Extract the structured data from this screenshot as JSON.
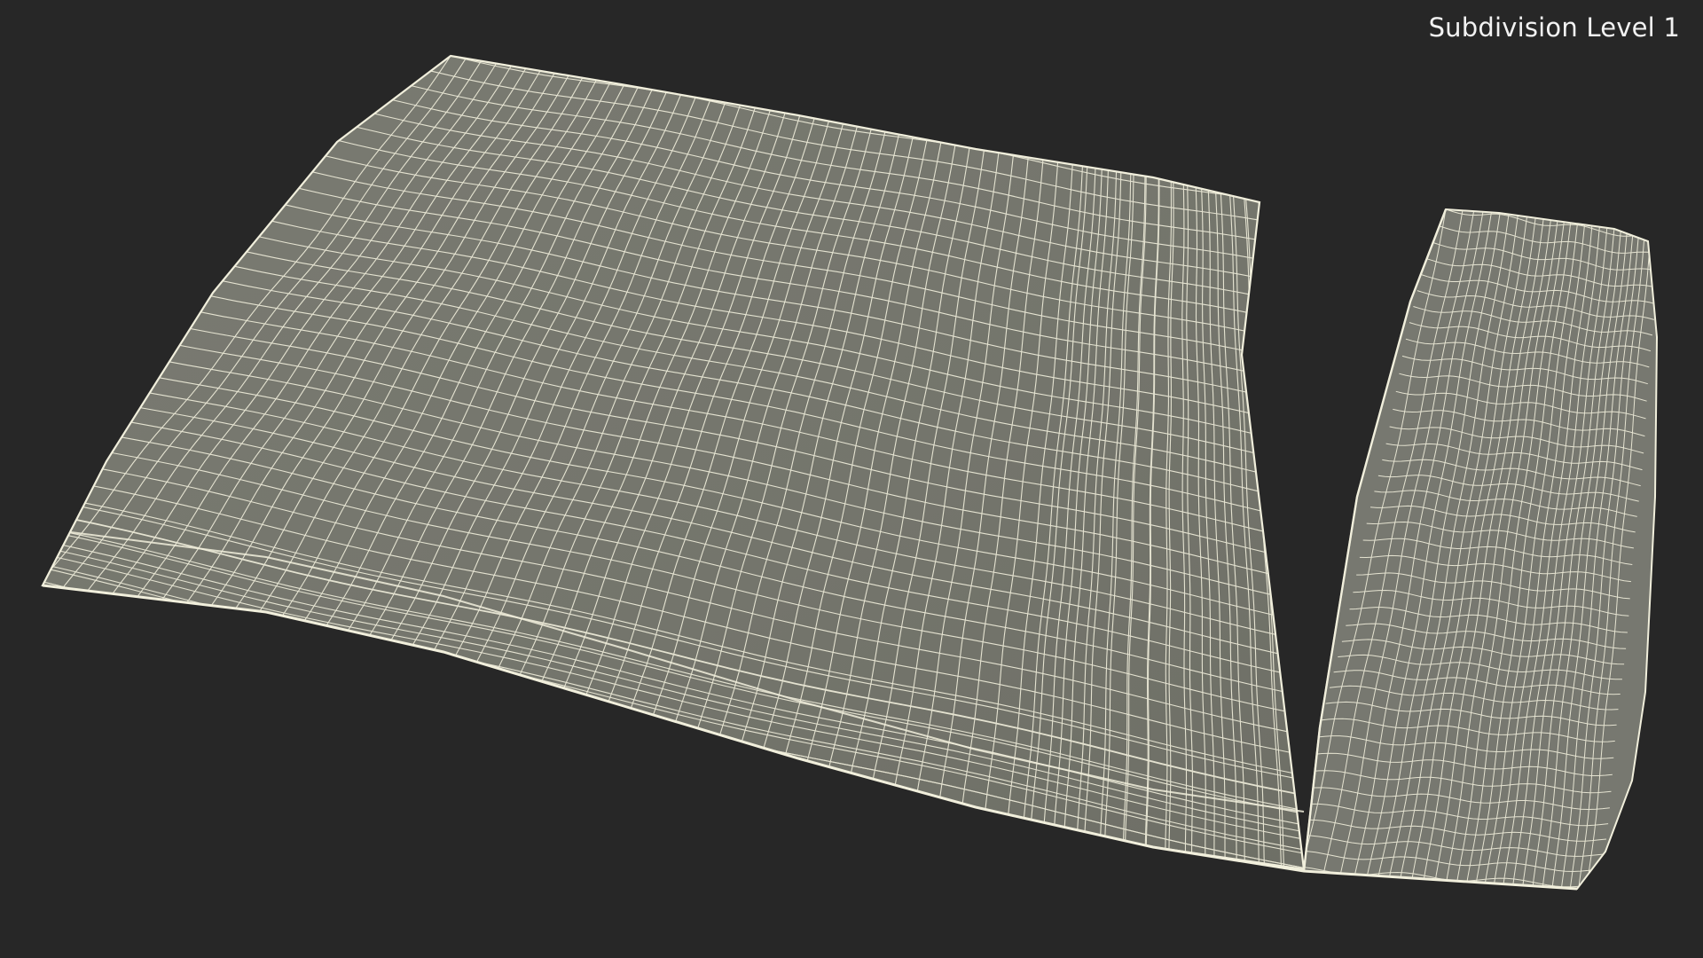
{
  "viewport": {
    "background_color": "#272727",
    "overlay_label": "Subdivision Level 1"
  },
  "model": {
    "surface_color": "#76776d",
    "wire_color": "#f1efdc",
    "shadow_color": "#5f6058"
  }
}
